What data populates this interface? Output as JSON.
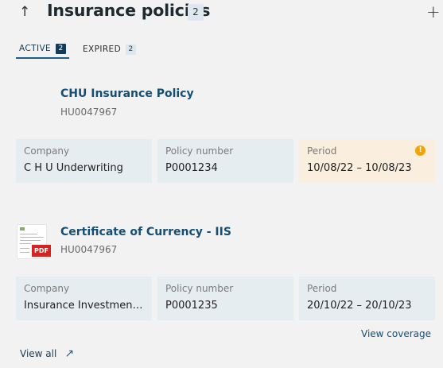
{
  "header": {
    "title": "Insurance policies",
    "count": "2",
    "collapse_icon": "arrow-up-icon",
    "add_icon": "plus-icon"
  },
  "tabs": [
    {
      "label": "ACTIVE",
      "count": "2",
      "active": true
    },
    {
      "label": "EXPIRED",
      "count": "2",
      "active": false
    }
  ],
  "policies": [
    {
      "title": "CHU Insurance Policy",
      "code": "HU0047967",
      "company_label": "Company",
      "company": "C H U Underwriting",
      "policy_number_label": "Policy number",
      "policy_number": "P0001234",
      "period_label": "Period",
      "period": "10/08/22 – 10/08/23",
      "period_warning": true
    },
    {
      "title": "Certificate of Currency - IIS",
      "code": "HU0047967",
      "document_type": "PDF",
      "company_label": "Company",
      "company": "Insurance Investment Solutions",
      "policy_number_label": "Policy number",
      "policy_number": "P0001235",
      "period_label": "Period",
      "period": "20/10/22 – 20/10/23",
      "period_warning": false
    }
  ],
  "actions": {
    "view_coverage": "View coverage",
    "view_all": "View all"
  },
  "colors": {
    "link": "#154e74",
    "field_bg": "#e6edf1",
    "warning_bg": "#faefdf",
    "warning_icon": "#f0a500",
    "pdf_red": "#d32323"
  }
}
